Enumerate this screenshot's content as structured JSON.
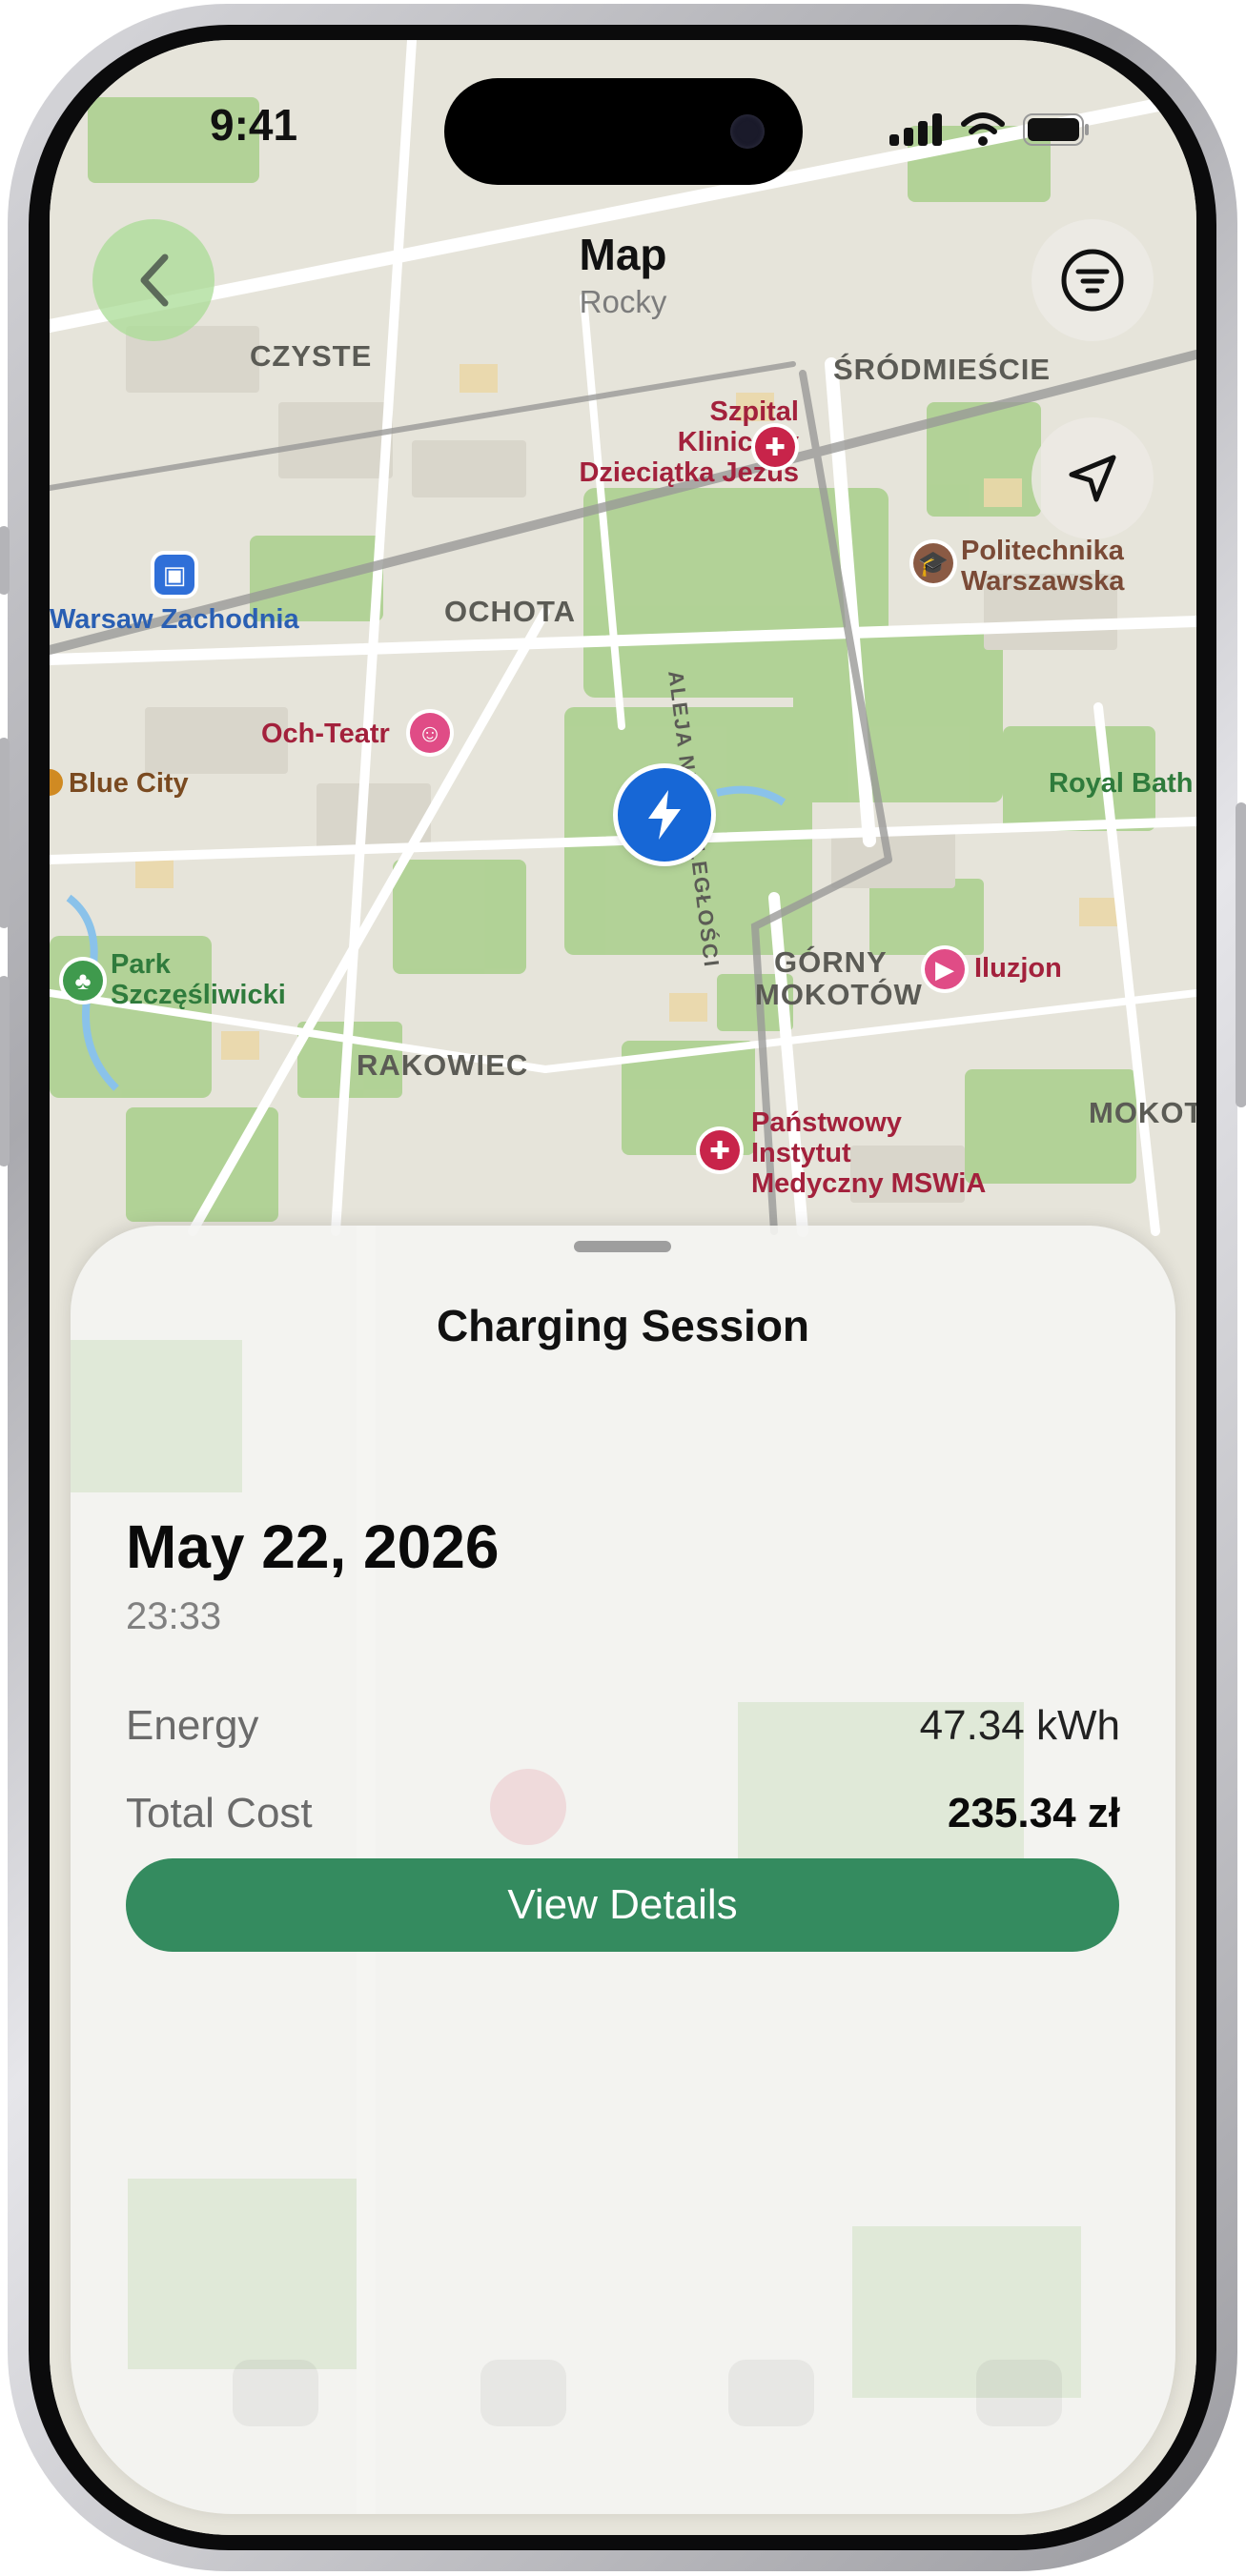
{
  "status_bar": {
    "time": "9:41"
  },
  "header": {
    "title": "Map",
    "subtitle": "Rocky"
  },
  "icons": {
    "back": "chevron-left-icon",
    "filter": "filter-lines-icon",
    "locate": "location-arrow-icon",
    "charger": "lightning-bolt-icon"
  },
  "map": {
    "districts": [
      "CZYSTE",
      "ŚRÓDMIEŚCIE",
      "OCHOTA",
      "RAKOWIEC",
      "GÓRNY",
      "MOKOTÓW",
      "MOKOT"
    ],
    "street": "ALEJA NIEPODLEGŁOŚCI",
    "pois": {
      "hospital_1": [
        "Szpital",
        "Kliniczny",
        "Dzieciątka Jezus"
      ],
      "university": [
        "Politechnika",
        "Warszawska"
      ],
      "station": "Warsaw Zachodnia",
      "theatre": "Och-Teatr",
      "blue_city": "Blue City",
      "royal_bath": "Royal Bath",
      "park": [
        "Park",
        "Szczęśliwicki"
      ],
      "cinema": "Iluzjon",
      "hospital_2": [
        "Państwowy",
        "Instytut",
        "Medyczny MSWiA"
      ]
    }
  },
  "sheet": {
    "title": "Charging Session",
    "date": "May 22, 2026",
    "time": "23:33",
    "energy_label": "Energy",
    "energy_value": "47.34 kWh",
    "cost_label": "Total Cost",
    "cost_value": "235.34 zł",
    "button_label": "View Details"
  },
  "colors": {
    "accent_green": "#348b5f",
    "charger_blue": "#1767d6",
    "poi_red": "#c8244a"
  }
}
